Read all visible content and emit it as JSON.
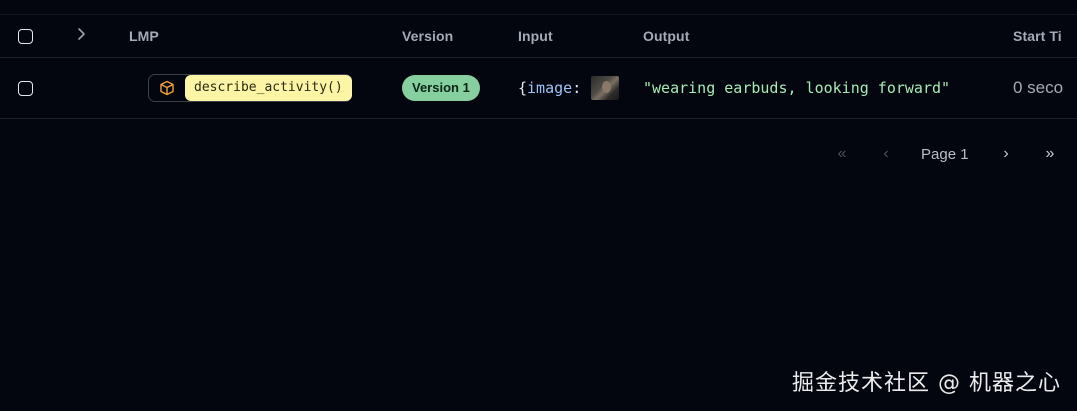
{
  "table": {
    "headers": {
      "lmp": "LMP",
      "version": "Version",
      "input": "Input",
      "output": "Output",
      "start_time": "Start Ti"
    },
    "expand_icon": "chevron-right-icon",
    "rows": [
      {
        "lmp_icon": "box-icon",
        "lmp_name": "describe_activity()",
        "version": "Version 1",
        "input_open": "{",
        "input_key": "image",
        "input_colon": ":",
        "output": "\"wearing earbuds, looking forward\"",
        "start_time": "0 seco"
      }
    ]
  },
  "pagination": {
    "first": "«",
    "prev": "‹",
    "label": "Page 1",
    "next": "›",
    "last": "»"
  },
  "watermark": "掘金技术社区 @ 机器之心",
  "colors": {
    "background": "#03060e",
    "lmp_highlight": "#fdf5a6",
    "version_badge": "#86d0a0",
    "output_text": "#a6ebb4",
    "input_key": "#9ec2f6",
    "lmp_icon": "#f0a33a"
  }
}
